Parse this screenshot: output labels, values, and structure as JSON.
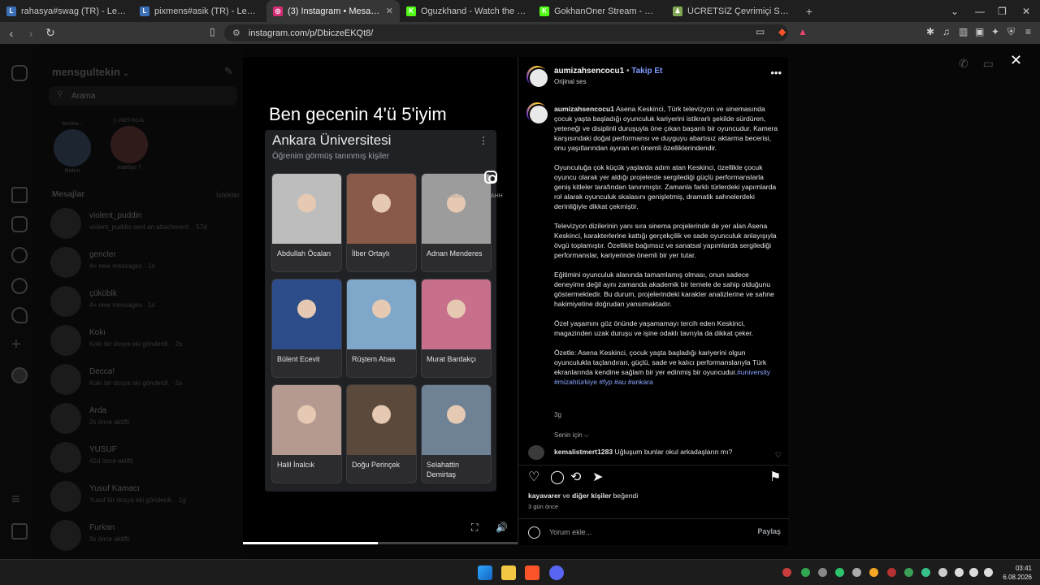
{
  "browser": {
    "tabs": [
      {
        "title": "rahasya#swag (TR) - LeagueOfGraphs",
        "fav": "L",
        "color": "#3b6fb6"
      },
      {
        "title": "pixmens#asik (TR) - LeagueOfGraphs",
        "fav": "L",
        "color": "#3b6fb6"
      },
      {
        "title": "(3) Instagram • Mesajlar",
        "fav": "◎",
        "color": "#d62976",
        "active": true
      },
      {
        "title": "Oguzkhand - Watch the VOD on Kick",
        "fav": "K",
        "color": "#53fc18"
      },
      {
        "title": "GokhanOner Stream - Watch Live on",
        "fav": "K",
        "color": "#53fc18"
      },
      {
        "title": "ÜCRETSİZ Çevrimiçi Satranç Oynayın",
        "fav": "♟",
        "color": "#7fa650"
      }
    ],
    "url": "instagram.com/p/DbiczeEKQt8/"
  },
  "inbox": {
    "username": "mensgultekin",
    "search_placeholder": "Arama",
    "notes": [
      {
        "label": "Notun",
        "bubble": "familkie..."
      },
      {
        "label": "maellys †",
        "bubble": "|| UNETHICAL"
      }
    ],
    "messages_header": "Mesajlar",
    "requests_label": "İstekler",
    "conversations": [
      {
        "name": "violent_puddin",
        "preview": "violent_puddin sent an attachment. · 57d"
      },
      {
        "name": "gencler",
        "preview": "4+ new messages · 1s"
      },
      {
        "name": "çüküblk",
        "preview": "4+ new messages · 1s"
      },
      {
        "name": "Kokı",
        "preview": "Kokı bir dosya eki gönderdi. · 2s"
      },
      {
        "name": "Decca!",
        "preview": "Kokı bir dosya eki gönderdi. · 5s"
      },
      {
        "name": "Arda",
        "preview": "2s önce aktifti"
      },
      {
        "name": "YUSUF",
        "preview": "41d önce aktifti"
      },
      {
        "name": "Yusuf Kamacı",
        "preview": "Yusuf bir dosya eki gönderdi. · 1g"
      },
      {
        "name": "Furkan",
        "preview": "8s önce aktifti"
      }
    ]
  },
  "video": {
    "overlay_title": "Ben gecenin 4'ü 5'iyim",
    "card_title": "Ankara Üniversitesi",
    "card_subtitle": "Öğrenim görmüş tanınmış kişiler",
    "watermark": "@KNOCKLESSMIZAHH",
    "people": [
      {
        "name": "Abdullah Öcalan",
        "tone": "#bdbdbd"
      },
      {
        "name": "İlber Ortaylı",
        "tone": "#8a5a48"
      },
      {
        "name": "Adnan Menderes",
        "tone": "#9c9c9c"
      },
      {
        "name": "Bülent Ecevit",
        "tone": "#2d4d8a"
      },
      {
        "name": "Rüştem Abas",
        "tone": "#7ea7c9"
      },
      {
        "name": "Murat Bardakçı",
        "tone": "#c76f8b"
      },
      {
        "name": "Halil İnalcık",
        "tone": "#b59a92"
      },
      {
        "name": "Doğu Perinçek",
        "tone": "#5b4a3c"
      },
      {
        "name": "Selahattin Demirtaş",
        "tone": "#6e8195"
      }
    ],
    "progress": 0.49
  },
  "post": {
    "author": "aumizahsencocu1",
    "follow_label": "Takip Et",
    "audio": "Orijinal ses",
    "caption": [
      "Asena Keskinci, Türk televizyon ve sinemasında çocuk yaşta başladığı oyunculuk kariyerini istikrarlı şekilde sürdüren, yeteneği ve disiplinli duruşuyla öne çıkan başarılı bir oyuncudur. Kamera karşısındaki doğal performansı ve duyguyu abartısız aktarma becerisi, onu yaşıtlarından ayıran en önemli özelliklerindendir.",
      "Oyunculuğa çok küçük yaşlarda adım atan Keskinci, özellikle çocuk oyuncu olarak yer aldığı projelerde sergilediği güçlü performanslarla geniş kitleler tarafından tanınmıştır. Zamanla farklı türlerdeki yapımlarda rol alarak oyunculuk skalasını genişletmiş, dramatik sahnelerdeki derinliğiyle dikkat çekmiştir.",
      "Televizyon dizilerinin yanı sıra sinema projelerinde de yer alan Asena Keskinci, karakterlerine kattığı gerçekçilik ve sade oyunculuk anlayışıyla övgü toplamıştır. Özellikle bağımsız ve sanatsal yapımlarda sergilediği performanslar, kariyerinde önemli bir yer tutar.",
      "Eğitimini oyunculuk alanında tamamlamış olması, onun sadece deneyime değil aynı zamanda akademik bir temele de sahip olduğunu göstermektedir. Bu durum, projelerindeki karakter analizlerine ve sahne hakimiyetine doğrudan yansımaktadır.",
      "Özel yaşamını göz önünde yaşamamayı tercih eden Keskinci, magazinden uzak duruşu ve işine odaklı tavrıyla da dikkat çeker.",
      "Özetle: Asena Keskinci, çocuk yaşta başladığı kariyerini olgun oyunculukla taçlandıran, güçlü, sade ve kalıcı performanslarıyla Türk ekranlarında kendine sağlam bir yer edinmiş bir oyuncudur."
    ],
    "hashtags": "#university #mizahtürkiye #fyp #au #ankara",
    "caption_time": "3g",
    "for_you": "Senin için ⌵",
    "comment": {
      "user": "kemalistmert1283",
      "text": "Uğluşum bunlar okul arkadaşların mı?"
    },
    "liked_by": {
      "user": "kayavarer",
      "connector": " ve ",
      "others": "diğer kişiler",
      "suffix": " beğendi"
    },
    "post_time": "3 gün önce",
    "comment_placeholder": "Yorum ekle...",
    "post_label": "Paylaş"
  },
  "taskbar": {
    "time": "03:41",
    "date": "6.08.2026"
  },
  "colors": {
    "link": "#8aa4ff",
    "story_ring": "#ee2a7b",
    "unread_dot": "#0095f6"
  }
}
